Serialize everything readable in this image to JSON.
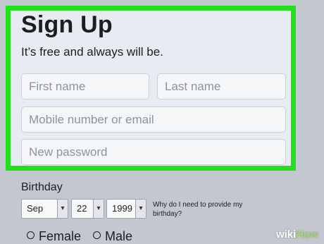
{
  "form": {
    "title": "Sign Up",
    "subtitle": "It’s free and always will be.",
    "first_name_placeholder": "First name",
    "last_name_placeholder": "Last name",
    "mobile_email_placeholder": "Mobile number or email",
    "password_placeholder": "New password"
  },
  "birthday": {
    "label": "Birthday",
    "month": "Sep",
    "day": "22",
    "year": "1999",
    "why_link": "Why do I need to provide my birthday?"
  },
  "gender": {
    "female_label": "Female",
    "male_label": "Male"
  },
  "watermark": {
    "part1": "wiki",
    "part2": "How"
  },
  "colors": {
    "highlight": "#22e01a",
    "panel": "#e9ebf2",
    "page": "#c5c7d0"
  }
}
